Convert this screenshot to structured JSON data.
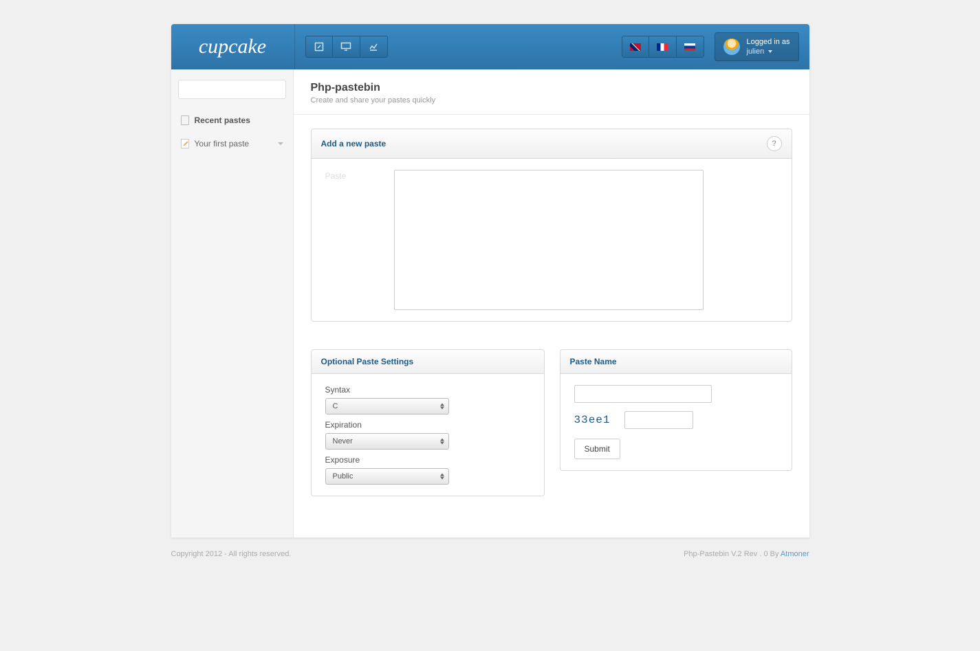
{
  "header": {
    "logo": "cupcake",
    "user": {
      "logged_in_as": "Logged in as",
      "username": "julien"
    }
  },
  "sidebar": {
    "recent_heading": "Recent pastes",
    "items": [
      {
        "label": "Your first paste"
      }
    ]
  },
  "page": {
    "title": "Php-pastebin",
    "subtitle": "Create and share your pastes quickly"
  },
  "add_paste": {
    "panel_title": "Add a new paste",
    "help": "?",
    "label": "Paste"
  },
  "settings": {
    "panel_title": "Optional Paste Settings",
    "syntax_label": "Syntax",
    "syntax_value": "C",
    "expiration_label": "Expiration",
    "expiration_value": "Never",
    "exposure_label": "Exposure",
    "exposure_value": "Public"
  },
  "name_panel": {
    "panel_title": "Paste Name",
    "captcha": "33ee1",
    "submit": "Submit"
  },
  "footer": {
    "left": "Copyright 2012 - All rights reserved.",
    "right_prefix": "Php-Pastebin V.2 Rev . 0 By ",
    "right_link": "Atmoner"
  }
}
